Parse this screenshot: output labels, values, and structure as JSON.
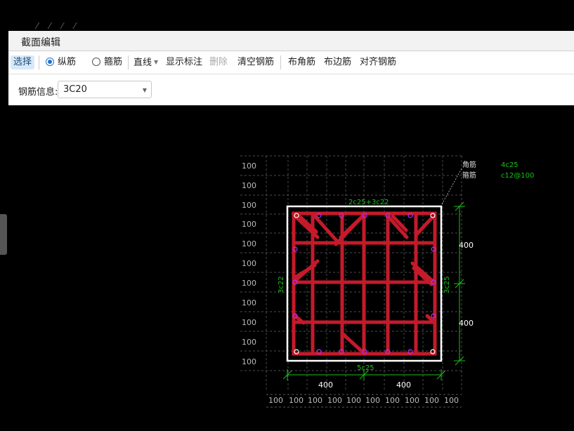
{
  "window": {
    "title": "截面编辑"
  },
  "toolbar": {
    "select_label": "选择",
    "radio_longitudinal": "纵筋",
    "radio_stirrup": "箍筋",
    "line_label": "直线",
    "show_annotation": "显示标注",
    "delete_label": "删除",
    "clear_rebar": "清空钢筋",
    "corner_rebar": "布角筋",
    "edge_rebar": "布边筋",
    "align_rebar": "对齐钢筋"
  },
  "info": {
    "label": "钢筋信息:",
    "value": "3C20"
  },
  "drawing": {
    "legend": {
      "corner_label": "角筋",
      "corner_value": "4c25",
      "stirrup_label": "箍筋",
      "stirrup_value": "c12@100"
    },
    "top_rebar": "2c25+3c22",
    "bottom_rebar": "5c25",
    "left_rebar": "3c22",
    "right_rebar": "3c25",
    "bottom_dims": [
      "400",
      "400"
    ],
    "right_dims": [
      "400",
      "400"
    ],
    "grid_label": "100",
    "colors": {
      "rebar": "#c41a2a",
      "dim": "#19c219",
      "outline": "#ffffff",
      "bars": "#b030ff"
    }
  }
}
